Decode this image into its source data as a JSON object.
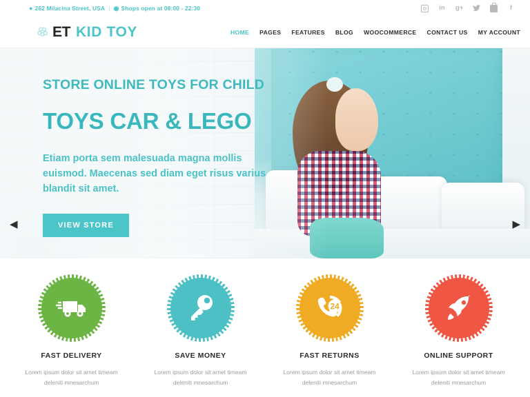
{
  "topbar": {
    "pin_icon": "location-pin-icon",
    "address": "262 Milacina Street, USA",
    "separator": "|",
    "clock_icon": "clock-icon",
    "hours": "Shops open at 08:00 - 22:30",
    "social": [
      {
        "name": "instagram-icon",
        "glyph": ""
      },
      {
        "name": "linkedin-icon",
        "glyph": "in"
      },
      {
        "name": "google-plus-icon",
        "glyph": "g+"
      },
      {
        "name": "twitter-icon",
        "glyph": "🐦"
      },
      {
        "name": "youtube-icon",
        "glyph": ""
      },
      {
        "name": "facebook-icon",
        "glyph": "f"
      }
    ]
  },
  "header": {
    "logo_mark": "atom-molecule-icon",
    "logo_primary": "ET",
    "logo_secondary": "KID TOY",
    "nav": [
      {
        "label": "HOME",
        "active": true
      },
      {
        "label": "PAGES",
        "active": false
      },
      {
        "label": "FEATURES",
        "active": false
      },
      {
        "label": "BLOG",
        "active": false
      },
      {
        "label": "WOOCOMMERCE",
        "active": false
      },
      {
        "label": "CONTACT US",
        "active": false
      },
      {
        "label": "MY ACCOUNT",
        "active": false
      }
    ]
  },
  "hero": {
    "subtitle": "STORE ONLINE TOYS FOR CHILD",
    "title": "TOYS CAR & LEGO",
    "description": "Etiam porta sem malesuada magna mollis euismod. Maecenas sed diam eget risus varius blandit sit amet.",
    "cta_label": "VIEW STORE",
    "prev_arrow": "◀",
    "next_arrow": "▶",
    "accent_color": "#4cc5c8"
  },
  "features": [
    {
      "icon": "delivery-truck-icon",
      "color": "#6cb545",
      "title": "FAST DELIVERY",
      "description": "Lorem ipsum dolor sit amet timeam deleniti mnesarchum"
    },
    {
      "icon": "key-icon",
      "color": "#4cc0c4",
      "title": "SAVE MONEY",
      "description": "Lorem ipsum dolor sit amet timeam deleniti mnesarchum"
    },
    {
      "icon": "phone-24-support-icon",
      "color": "#f0ab24",
      "title": "FAST RETURNS",
      "description": "Lorem ipsum dolor sit amet timeam deleniti mnesarchum"
    },
    {
      "icon": "rocket-icon",
      "color": "#ef5744",
      "title": "ONLINE SUPPORT",
      "description": "Lorem ipsum dolor sit amet timeam deleniti mnesarchum"
    }
  ]
}
